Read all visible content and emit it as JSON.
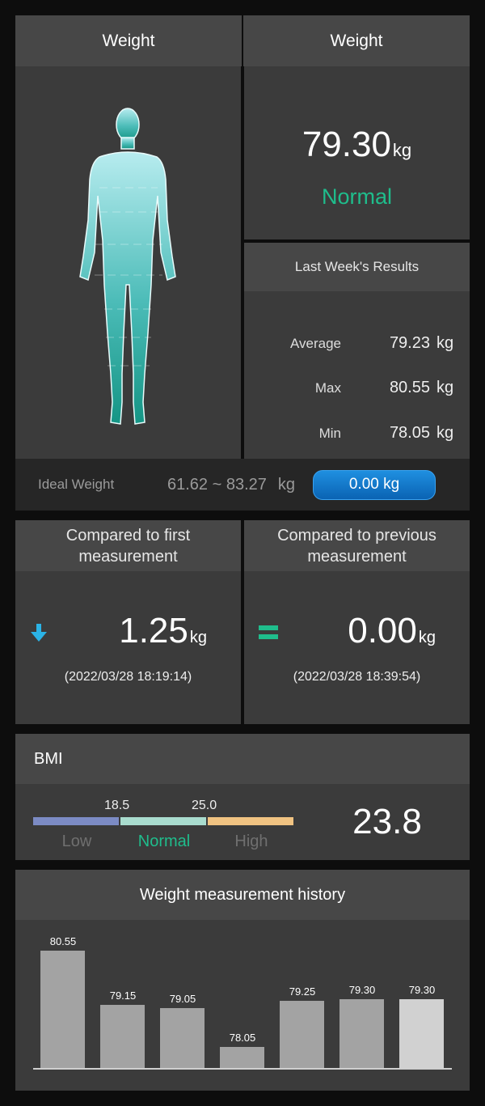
{
  "top": {
    "left_header": "Weight",
    "right_header": "Weight",
    "current_value": "79.30",
    "current_unit": "kg",
    "current_status": "Normal",
    "week_title": "Last Week's Results",
    "week_rows": [
      {
        "label": "Average",
        "value": "79.23",
        "unit": "kg"
      },
      {
        "label": "Max",
        "value": "80.55",
        "unit": "kg"
      },
      {
        "label": "Min",
        "value": "78.05",
        "unit": "kg"
      }
    ],
    "ideal_label": "Ideal Weight",
    "ideal_range": "61.62 ~ 83.27",
    "ideal_unit": "kg",
    "ideal_button": "0.00 kg"
  },
  "compare": {
    "first": {
      "title": "Compared to first measurement",
      "value": "1.25",
      "unit": "kg",
      "timestamp": "(2022/03/28 18:19:14)",
      "icon": "arrow-down-icon"
    },
    "previous": {
      "title": "Compared to previous measurement",
      "value": "0.00",
      "unit": "kg",
      "timestamp": "(2022/03/28 18:39:54)",
      "icon": "equals-icon"
    }
  },
  "bmi": {
    "title": "BMI",
    "value": "23.8",
    "thresholds": [
      "18.5",
      "25.0"
    ],
    "ranges": [
      "Low",
      "Normal",
      "High"
    ],
    "colors": {
      "low": "#7c8bc4",
      "normal": "#a9dcce",
      "high": "#f0c382",
      "normal_text": "#1fbd8c"
    }
  },
  "chart_data": {
    "type": "bar",
    "title": "Weight measurement history",
    "values": [
      80.55,
      79.15,
      79.05,
      78.05,
      79.25,
      79.3,
      79.3
    ],
    "labels": [
      "80.55",
      "79.15",
      "79.05",
      "78.05",
      "79.25",
      "79.30",
      "79.30"
    ],
    "xlabel": "",
    "ylabel": ""
  }
}
